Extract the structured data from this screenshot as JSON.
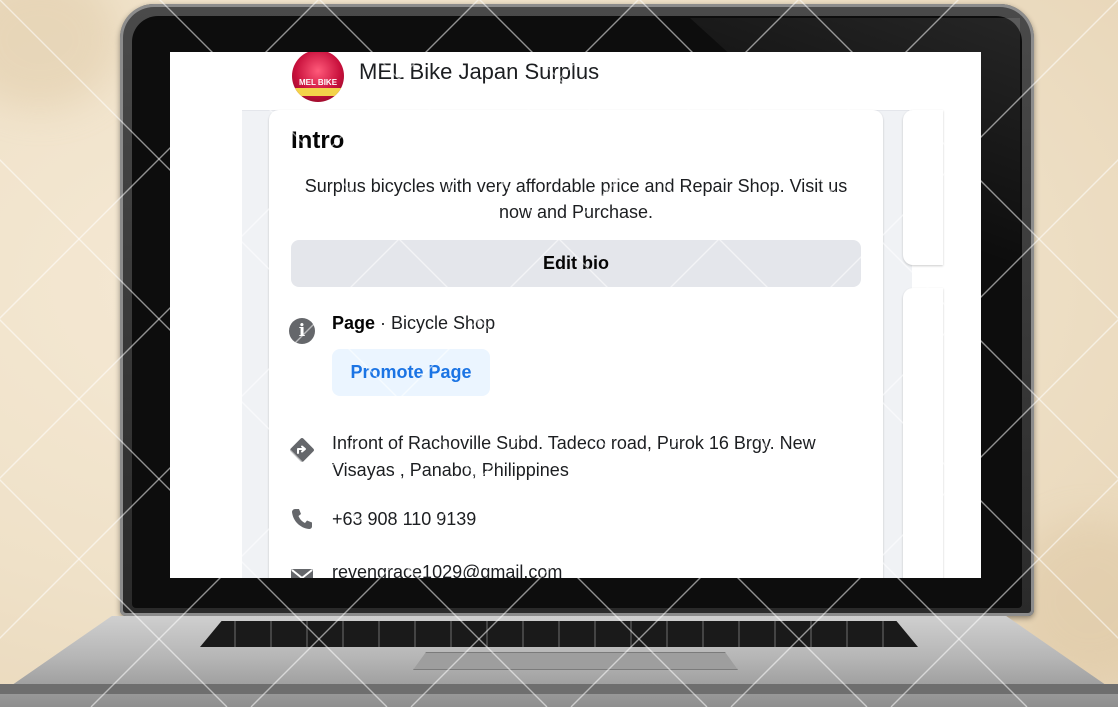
{
  "header": {
    "page_name": "MEL Bike Japan Surplus",
    "avatar_text": "MEL BIKE"
  },
  "intro": {
    "title": "Intro",
    "bio": "Surplus bicycles with very affordable price and Repair Shop. Visit us now and Purchase.",
    "edit_bio_label": "Edit bio",
    "page_label": "Page",
    "page_category": " · Bicycle Shop",
    "promote_label": "Promote Page",
    "address": "Infront of Rachoville Subd. Tadeco road, Purok 16 Brgy. New Visayas , Panabo, Philippines",
    "phone": "+63 908 110 9139",
    "email": "revengrace1029@gmail.com"
  },
  "icons": {
    "info": "info-icon",
    "directions": "directions-icon",
    "phone": "phone-icon",
    "mail": "mail-icon"
  },
  "colors": {
    "accent": "#1b74e4",
    "promote_bg": "#ebf5ff",
    "button_bg": "#e4e6eb",
    "icon_gray": "#65676b"
  }
}
